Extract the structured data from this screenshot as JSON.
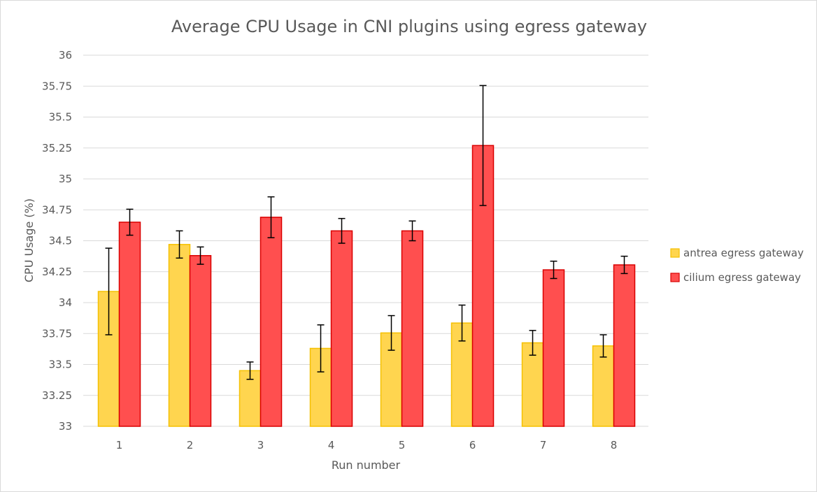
{
  "chart_data": {
    "type": "bar",
    "title": "Average CPU Usage in CNI plugins using egress gateway",
    "xlabel": "Run number",
    "ylabel": "CPU Usage (%)",
    "ylim": [
      33,
      36
    ],
    "yticks": [
      "33",
      "33.25",
      "33.5",
      "33.75",
      "34",
      "34.25",
      "34.5",
      "34.75",
      "35",
      "35.25",
      "35.5",
      "35.75",
      "36"
    ],
    "categories": [
      "1",
      "2",
      "3",
      "4",
      "5",
      "6",
      "7",
      "8"
    ],
    "grid": true,
    "legend_position": "right",
    "series": [
      {
        "name": "antrea egress gateway",
        "color": "#ffd54f",
        "stroke": "#f5c000",
        "values": [
          34.09,
          34.47,
          33.45,
          33.63,
          33.755,
          33.835,
          33.675,
          33.65
        ],
        "errors": [
          0.35,
          0.11,
          0.07,
          0.19,
          0.14,
          0.145,
          0.1,
          0.09
        ]
      },
      {
        "name": "cilium egress gateway",
        "color": "#ff4f4f",
        "stroke": "#d90000",
        "values": [
          34.65,
          34.38,
          34.69,
          34.58,
          34.58,
          35.27,
          34.265,
          34.305
        ],
        "errors": [
          0.105,
          0.07,
          0.165,
          0.1,
          0.08,
          0.485,
          0.07,
          0.07
        ]
      }
    ]
  }
}
